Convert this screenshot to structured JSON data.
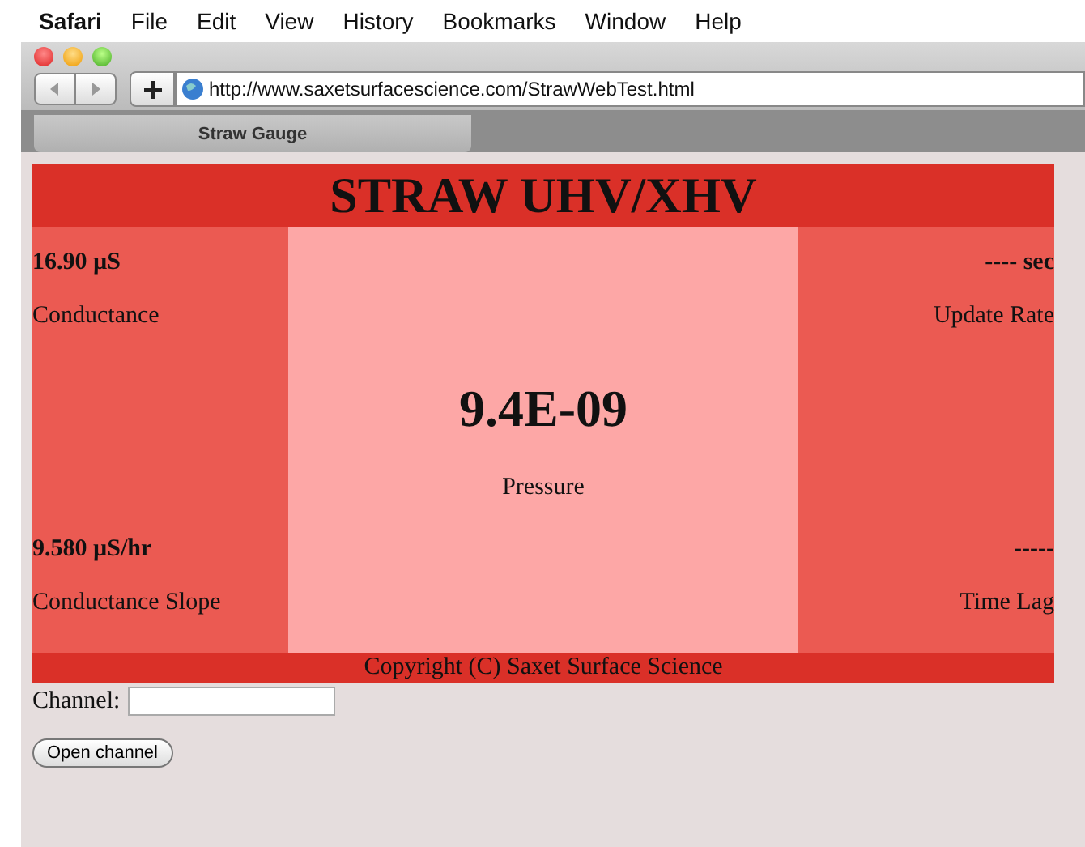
{
  "menu_bar": {
    "app": "Safari",
    "items": [
      "File",
      "Edit",
      "View",
      "History",
      "Bookmarks",
      "Window",
      "Help"
    ]
  },
  "toolbar": {
    "address": "http://www.saxetsurfacescience.com/StrawWebTest.html"
  },
  "tabs": [
    {
      "label": "Straw Gauge",
      "selected": true
    }
  ],
  "page": {
    "title": "STRAW UHV/XHV",
    "left": [
      {
        "value": "16.90 µS",
        "label": "Conductance"
      },
      {
        "value": "9.580 µS/hr",
        "label": "Conductance Slope"
      }
    ],
    "center": {
      "value": "9.4E-09",
      "label": "Pressure"
    },
    "right": [
      {
        "value": "---- sec",
        "label": "Update Rate"
      },
      {
        "value": "-----",
        "label": "Time Lag"
      }
    ],
    "footer": "Copyright (C) Saxet Surface Science",
    "channel_label": "Channel:",
    "button": "Open channel"
  }
}
